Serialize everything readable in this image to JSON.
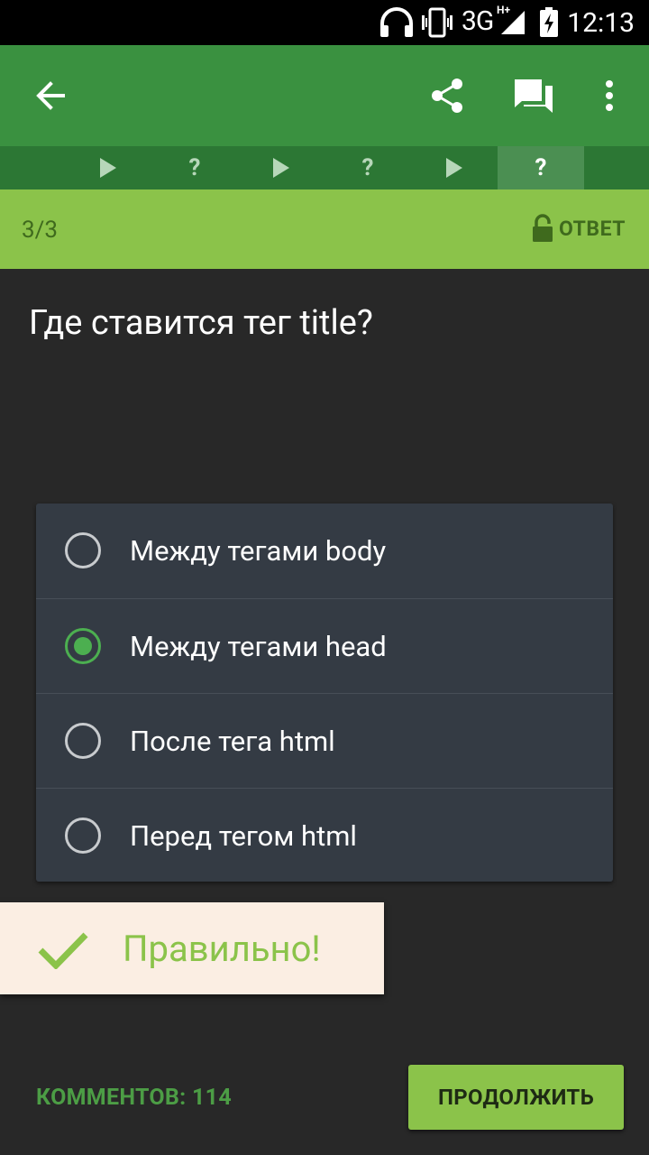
{
  "status_bar": {
    "network": "3G",
    "network_badge": "H+",
    "time": "12:13"
  },
  "app_bar": {
    "back_icon": "arrow-left-icon",
    "share_icon": "share-icon",
    "comments_icon": "forum-icon",
    "menu_icon": "more-vert-icon"
  },
  "progress_steps": [
    {
      "type": "theory",
      "icon": "play-icon"
    },
    {
      "type": "question",
      "label": "?"
    },
    {
      "type": "theory",
      "icon": "play-icon"
    },
    {
      "type": "question",
      "label": "?"
    },
    {
      "type": "theory",
      "icon": "play-icon"
    },
    {
      "type": "question",
      "label": "?",
      "active": true
    }
  ],
  "counter": {
    "text": "3/3",
    "answer_label": "ОТВЕТ"
  },
  "question": {
    "text": "Где ставится тег title?"
  },
  "options": [
    {
      "label": "Между тегами body",
      "selected": false
    },
    {
      "label": "Между тегами head",
      "selected": true
    },
    {
      "label": "После тега html",
      "selected": false
    },
    {
      "label": "Перед тегом html",
      "selected": false
    }
  ],
  "result": {
    "text": "Правильно!"
  },
  "footer": {
    "comments_label": "КОММЕНТОВ: 114",
    "continue_label": "ПРОДОЛЖИТЬ"
  },
  "colors": {
    "app_bar": "#3a9140",
    "accent": "#8bc34a",
    "radio_selected": "#4caf50",
    "background": "#282828"
  }
}
